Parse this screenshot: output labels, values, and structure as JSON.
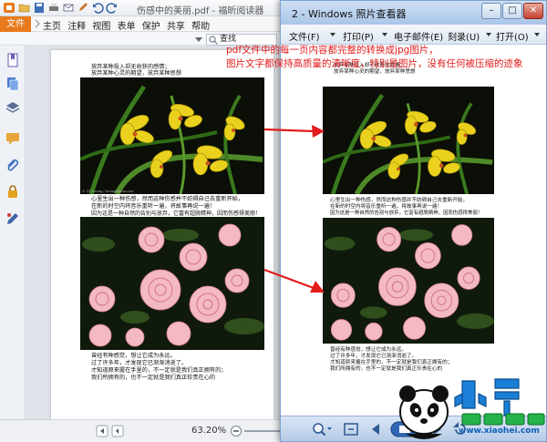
{
  "reader": {
    "doc_title": "伤感中的美丽.pdf - 福昕阅读器",
    "file_tab": "文件",
    "menus": [
      "主页",
      "注释",
      "视图",
      "表单",
      "保护",
      "共享",
      "帮助"
    ],
    "search_placeholder": "查找",
    "zoom": "63.20%"
  },
  "viewer": {
    "title": "2 - Windows 照片查看器",
    "menus": [
      "文件(F)",
      "打印(P)",
      "电子邮件(E)",
      "刻录(U)",
      "打开(O)"
    ],
    "close_glyph": "✕",
    "min_glyph": "–",
    "max_glyph": "□"
  },
  "annotation": {
    "line1": "pdf文件中的每一页内容都完整的转换成jpg图片，",
    "line2": "图片文字都保持高质量的清晰度，特别是图片，没有任何被压缩的迹象"
  },
  "page_text": {
    "top1": "放弃某种投入却无收获的感情；",
    "top2": "放弃某种心灵的期望，放弃某种思想",
    "mid1": "心里生出一种伤感，然而这种伤感并不妨碍自己去重新开始，",
    "mid2": "在新的时空内将音乐重听一遍，将故事再说一遍！",
    "mid3": "因为这是一种自然的告别与放弃，它富有超脱精神，因而伤感得美丽！",
    "bot1": "曾经有种感觉，想让它成为永远。",
    "bot2": "过了许多年，才发现它已渐渐消逝了。",
    "bot3": "才知道原来握在手里的，不一定就是我们真正拥有的；",
    "bot4": "我们所拥有的，也不一定就是我们真正珍贵在心的",
    "photo_credit": "© QT Luong / terragalleria.com"
  },
  "watermark": {
    "url": "www.xiaohei.com"
  },
  "colors": {
    "annotation": "#e21b1b",
    "file_tab": "#e8791c",
    "viewer_title": "#a9c6e8"
  }
}
